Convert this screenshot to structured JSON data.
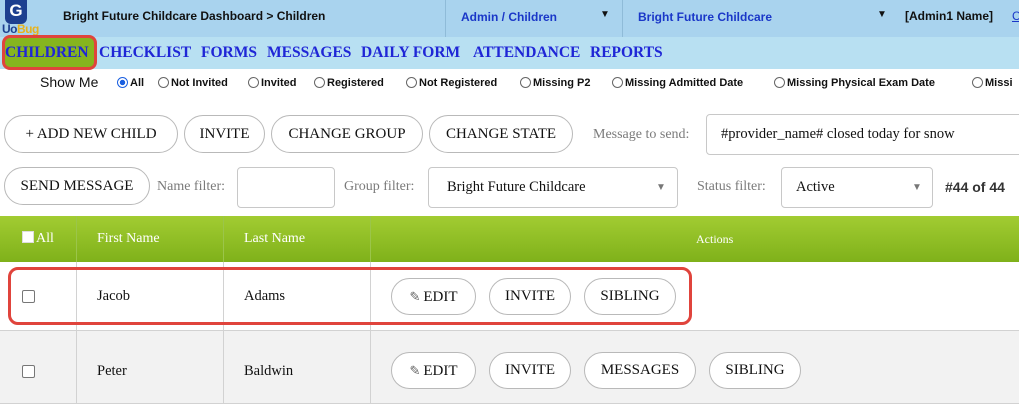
{
  "topbar": {
    "logo_letter": "G",
    "logo_text_main": "Uo",
    "logo_text_accent": "Bug",
    "title": "Bright Future Childcare Dashboard > Children",
    "role_select": "Admin / Children",
    "org_select": "Bright Future Childcare",
    "user": "[Admin1 Name]",
    "cut_link": "C"
  },
  "nav": {
    "items": [
      "CHILDREN",
      "CHECKLIST",
      "FORMS",
      "MESSAGES",
      "DAILY FORM",
      "ATTENDANCE",
      "REPORTS"
    ],
    "active": "CHILDREN"
  },
  "show_me": {
    "label": "Show Me",
    "options": [
      "All",
      "Not Invited",
      "Invited",
      "Registered",
      "Not Registered",
      "Missing P2",
      "Missing Admitted Date",
      "Missing Physical Exam Date",
      "Missi"
    ],
    "selected": "All"
  },
  "toolbar": {
    "add_child": "+ ADD NEW CHILD",
    "invite": "INVITE",
    "change_group": "CHANGE GROUP",
    "change_state": "CHANGE STATE",
    "message_label": "Message to send:",
    "message_value": "#provider_name# closed today for snow",
    "send_message": "SEND MESSAGE",
    "name_filter_label": "Name filter:",
    "name_filter_value": "",
    "group_filter_label": "Group filter:",
    "group_filter_value": "Bright Future Childcare",
    "status_filter_label": "Status filter:",
    "status_filter_value": "Active",
    "count": "#44 of 44"
  },
  "table": {
    "headers": {
      "select_all": "All",
      "first_name": "First Name",
      "last_name": "Last Name",
      "actions": "Actions"
    },
    "rows": [
      {
        "first": "Jacob",
        "last": "Adams",
        "actions": [
          "EDIT",
          "INVITE",
          "SIBLING"
        ]
      },
      {
        "first": "Peter",
        "last": "Baldwin",
        "actions": [
          "EDIT",
          "INVITE",
          "MESSAGES",
          "SIBLING"
        ]
      }
    ]
  },
  "colors": {
    "topbar": "#a9d3ee",
    "navbar": "#b8e0f2",
    "nav_link": "#1f26d6",
    "table_header": "#8fbf25",
    "highlight": "#e0443c"
  }
}
